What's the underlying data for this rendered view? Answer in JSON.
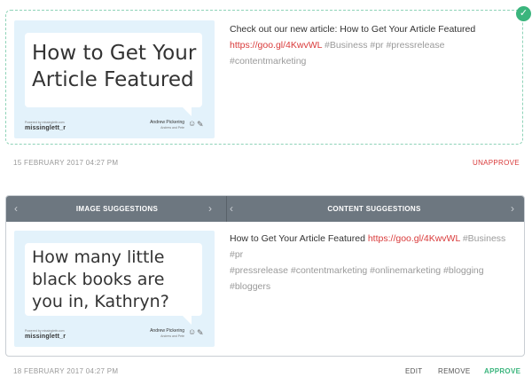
{
  "card1": {
    "status_icon": "checkmark-icon",
    "image": {
      "headline_line1": "How to Get Your",
      "headline_line2": "Article Featured",
      "brand_powered": "Powered by missinglettr.com",
      "brand_name": "missinglett_r",
      "author_name": "Andrew Pickering",
      "author_sub": "Andrew and Pete"
    },
    "text_line1": "Check out our new article: How to Get Your Article Featured",
    "link": "https://goo.gl/4KwvWL",
    "tags": "#Business #pr #pressrelease #contentmarketing",
    "date": "15 FEBRUARY 2017 04:27 PM",
    "unapprove_label": "UNAPPROVE"
  },
  "card2": {
    "image_tab_label": "IMAGE SUGGESTIONS",
    "content_tab_label": "CONTENT SUGGESTIONS",
    "image": {
      "headline_line1": "How many little",
      "headline_line2": "black books are",
      "headline_line3": "you in, Kathryn?",
      "brand_powered": "Powered by missinglettr.com",
      "brand_name": "missinglett_r",
      "author_name": "Andrew Pickering",
      "author_sub": "Andrew and Pete"
    },
    "text_intro": "How to Get Your Article Featured",
    "link": "https://goo.gl/4KwvWL",
    "tags_line1": "#Business #pr",
    "tags_line2": "#pressrelease #contentmarketing #onlinemarketing #blogging #bloggers",
    "date": "18 FEBRUARY 2017 04:27 PM",
    "edit_label": "EDIT",
    "remove_label": "REMOVE",
    "approve_label": "APPROVE"
  },
  "colors": {
    "accent_red": "#d93a3a",
    "approve_green": "#3bb57d",
    "tab_bar": "#6d7780",
    "image_bg": "#e3f2fb"
  }
}
